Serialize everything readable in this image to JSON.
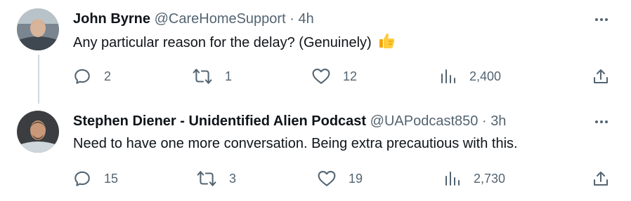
{
  "tweets": [
    {
      "name": "John Byrne",
      "handle": "@CareHomeSupport",
      "separator": "·",
      "time": "4h",
      "text": "Any particular reason for the delay? (Genuinely)",
      "emoji": "thumbs-up",
      "replies": "2",
      "retweets": "1",
      "likes": "12",
      "views": "2,400"
    },
    {
      "name": "Stephen Diener - Unidentified Alien Podcast",
      "handle": "@UAPodcast850",
      "separator": "·",
      "time": "3h",
      "text": "Need to have one more conversation. Being extra precautious with this.",
      "replies": "15",
      "retweets": "3",
      "likes": "19",
      "views": "2,730"
    }
  ],
  "icons": [
    "reply-icon",
    "retweet-icon",
    "like-icon",
    "views-icon",
    "share-icon",
    "more-icon",
    "thumbs-up-emoji"
  ],
  "colors": {
    "text": "#0f1419",
    "secondary": "#536471",
    "thread_line": "#cfd9de"
  }
}
